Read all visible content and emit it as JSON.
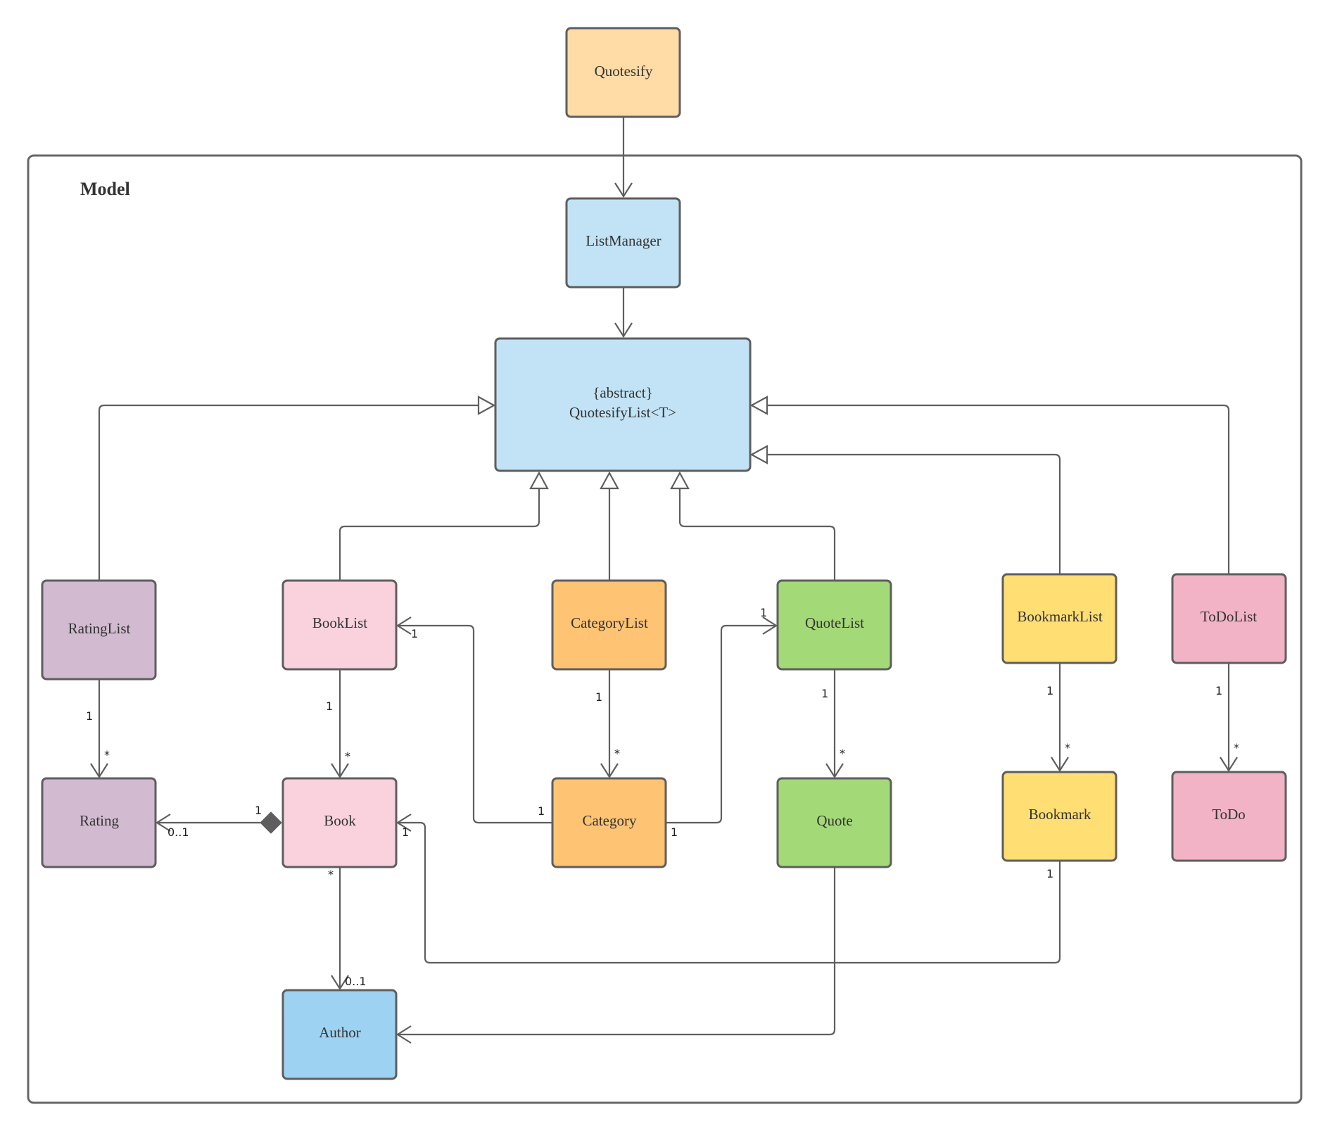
{
  "diagram": {
    "type": "uml-class-diagram",
    "frame": {
      "label": "Model"
    },
    "classes": [
      {
        "id": "quotesify",
        "label": "Quotesify",
        "fill": "#FFDBA6"
      },
      {
        "id": "listmanager",
        "label": "ListManager",
        "fill": "#C2E3F5"
      },
      {
        "id": "quotesifylist",
        "stereotype": "{abstract}",
        "label": "QuotesifyList<T>",
        "fill": "#C2E3F5"
      },
      {
        "id": "ratinglist",
        "label": "RatingList",
        "fill": "#D2BBD1"
      },
      {
        "id": "booklist",
        "label": "BookList",
        "fill": "#F9D2DE"
      },
      {
        "id": "categorylist",
        "label": "CategoryList",
        "fill": "#FEC373"
      },
      {
        "id": "quotelist",
        "label": "QuoteList",
        "fill": "#A4D977"
      },
      {
        "id": "bookmarklist",
        "label": "BookmarkList",
        "fill": "#FFDE73"
      },
      {
        "id": "todolist",
        "label": "ToDoList",
        "fill": "#F3B3C6"
      },
      {
        "id": "rating",
        "label": "Rating",
        "fill": "#D2BBD1"
      },
      {
        "id": "book",
        "label": "Book",
        "fill": "#F9D2DE"
      },
      {
        "id": "category",
        "label": "Category",
        "fill": "#FEC373"
      },
      {
        "id": "quote",
        "label": "Quote",
        "fill": "#A4D977"
      },
      {
        "id": "bookmark",
        "label": "Bookmark",
        "fill": "#FFDE73"
      },
      {
        "id": "todo",
        "label": "ToDo",
        "fill": "#F3B3C6"
      },
      {
        "id": "author",
        "label": "Author",
        "fill": "#9ED2F2"
      }
    ],
    "relationships": [
      {
        "from": "quotesify",
        "to": "listmanager",
        "kind": "association"
      },
      {
        "from": "listmanager",
        "to": "quotesifylist",
        "kind": "association"
      },
      {
        "from": "ratinglist",
        "to": "quotesifylist",
        "kind": "inheritance"
      },
      {
        "from": "booklist",
        "to": "quotesifylist",
        "kind": "inheritance"
      },
      {
        "from": "categorylist",
        "to": "quotesifylist",
        "kind": "inheritance"
      },
      {
        "from": "quotelist",
        "to": "quotesifylist",
        "kind": "inheritance"
      },
      {
        "from": "bookmarklist",
        "to": "quotesifylist",
        "kind": "inheritance"
      },
      {
        "from": "todolist",
        "to": "quotesifylist",
        "kind": "inheritance"
      },
      {
        "from": "ratinglist",
        "to": "rating",
        "kind": "association",
        "from_mult": "1",
        "to_mult": "*"
      },
      {
        "from": "booklist",
        "to": "book",
        "kind": "association",
        "from_mult": "1",
        "to_mult": "*"
      },
      {
        "from": "categorylist",
        "to": "category",
        "kind": "association",
        "from_mult": "1",
        "to_mult": "*"
      },
      {
        "from": "quotelist",
        "to": "quote",
        "kind": "association",
        "from_mult": "1",
        "to_mult": "*"
      },
      {
        "from": "bookmarklist",
        "to": "bookmark",
        "kind": "association",
        "from_mult": "1",
        "to_mult": "*"
      },
      {
        "from": "todolist",
        "to": "todo",
        "kind": "association",
        "from_mult": "1",
        "to_mult": "*"
      },
      {
        "from": "category",
        "to": "booklist",
        "kind": "association",
        "from_mult": "1",
        "to_mult": "1"
      },
      {
        "from": "category",
        "to": "quotelist",
        "kind": "association",
        "from_mult": "1",
        "to_mult": "1"
      },
      {
        "from": "book",
        "to": "rating",
        "kind": "composition",
        "from_mult": "1",
        "to_mult": "0..1"
      },
      {
        "from": "book",
        "to": "author",
        "kind": "association",
        "from_mult": "*",
        "to_mult": "0..1"
      },
      {
        "from": "bookmark",
        "to": "book",
        "kind": "association",
        "from_mult": "1",
        "to_mult": "1"
      },
      {
        "from": "quote",
        "to": "author",
        "kind": "association"
      }
    ],
    "multiplicity_labels": {
      "ratinglist_rating_src": "1",
      "ratinglist_rating_dst": "*",
      "booklist_book_src": "1",
      "booklist_book_dst": "*",
      "categorylist_category_src": "1",
      "categorylist_category_dst": "*",
      "quotelist_quote_src": "1",
      "quotelist_quote_dst": "*",
      "bookmarklist_bookmark_src": "1",
      "bookmarklist_bookmark_dst": "*",
      "todolist_todo_src": "1",
      "todolist_todo_dst": "*",
      "category_booklist_src": "1",
      "category_booklist_dst": "1",
      "category_quotelist_src": "1",
      "category_quotelist_dst": "1",
      "book_rating_src": "1",
      "book_rating_dst": "0..1",
      "book_author_src": "*",
      "book_author_dst": "0..1",
      "bookmark_book_src": "1",
      "bookmark_book_dst": "1"
    }
  }
}
